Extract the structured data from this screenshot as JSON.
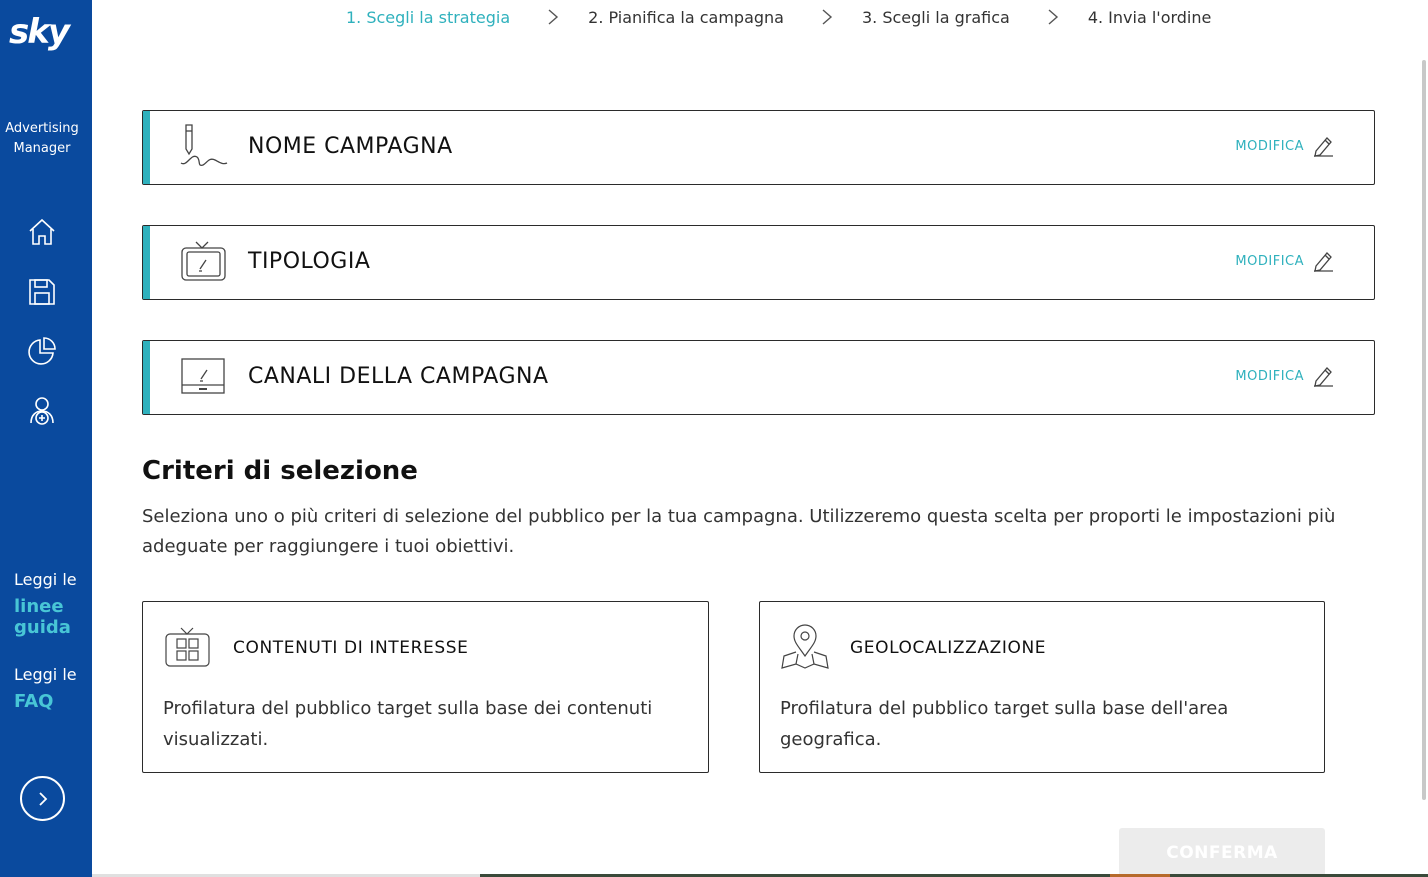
{
  "brand": {
    "logo": "sky",
    "app_name_line1": "Advertising",
    "app_name_line2": "Manager"
  },
  "sidebar": {
    "nav_icons": [
      "home-icon",
      "save-icon",
      "pie-chart-icon",
      "user-add-icon"
    ],
    "guide_prefix": "Leggi le",
    "guide_link_1": "linee",
    "guide_link_2": "guida",
    "faq_prefix": "Leggi le",
    "faq_link": "FAQ"
  },
  "stepper": {
    "steps": [
      {
        "label": "1. Scegli la strategia",
        "active": true
      },
      {
        "label": "2. Pianifica la campagna",
        "active": false
      },
      {
        "label": "3. Scegli la grafica",
        "active": false
      },
      {
        "label": "4. Invia l'ordine",
        "active": false
      }
    ]
  },
  "cards": [
    {
      "title": "NOME CAMPAGNA",
      "edit_label": "MODIFICA",
      "icon": "signature-pen-icon"
    },
    {
      "title": "TIPOLOGIA",
      "edit_label": "MODIFICA",
      "icon": "tv-icon"
    },
    {
      "title": "CANALI DELLA CAMPAGNA",
      "edit_label": "MODIFICA",
      "icon": "screen-channel-icon"
    }
  ],
  "criteria": {
    "title": "Criteri di selezione",
    "description": "Seleziona uno o più criteri di selezione del pubblico per la tua campagna. Utilizzeremo questa scelta per proporti le impostazioni più adeguate per raggiungere i tuoi obiettivi.",
    "options": [
      {
        "title": "CONTENUTI DI INTERESSE",
        "description": "Profilatura del pubblico target sulla base dei contenuti visualizzati.",
        "icon": "tv-grid-icon"
      },
      {
        "title": "GEOLOCALIZZAZIONE",
        "description": "Profilatura del pubblico target sulla base dell'area geografica.",
        "icon": "map-pin-icon"
      }
    ]
  },
  "actions": {
    "confirm_label": "CONFERMA"
  },
  "colors": {
    "sidebar_bg": "#0a4a9e",
    "accent": "#2fb1bd"
  }
}
